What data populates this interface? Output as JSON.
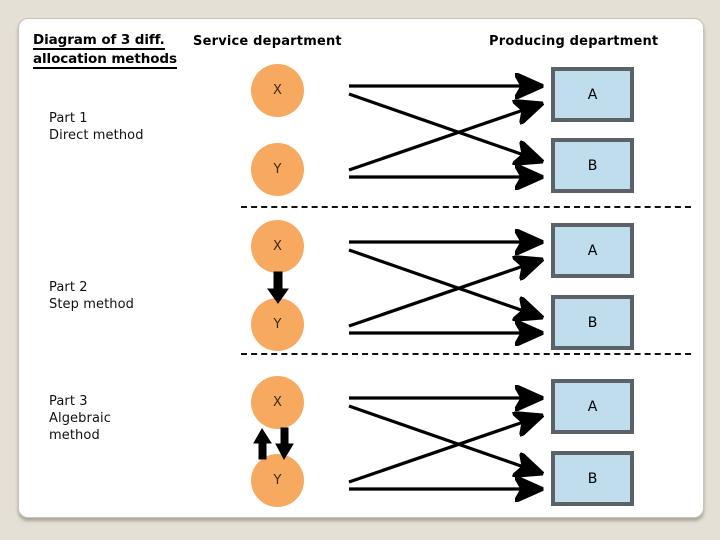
{
  "slide": {
    "title_line1": "Diagram of 3 diff.",
    "title_line2": "allocation methods",
    "column_headers": {
      "service": "Service department",
      "producing": "Producing department"
    },
    "colors": {
      "background": "#e5e0d6",
      "card": "#ffffff",
      "service_node_fill": "#f6a95f",
      "producing_node_fill": "#bfdded",
      "producing_node_border": "#5b6267",
      "arrow": "#000000",
      "divider": "#111111"
    },
    "sections": [
      {
        "id": "part-1",
        "label_line1": "Part 1",
        "label_line2": "Direct method",
        "label": "Part 1\nDirect method",
        "service_nodes": [
          "X",
          "Y"
        ],
        "producing_nodes": [
          "A",
          "B"
        ],
        "internal_arrows": [],
        "flow_arrows": [
          {
            "from": "X",
            "to": "A"
          },
          {
            "from": "X",
            "to": "B"
          },
          {
            "from": "Y",
            "to": "A"
          },
          {
            "from": "Y",
            "to": "B"
          }
        ]
      },
      {
        "id": "part-2",
        "label_line1": "Part 2",
        "label_line2": "Step method",
        "label": "Part 2\nStep method",
        "service_nodes": [
          "X",
          "Y"
        ],
        "producing_nodes": [
          "A",
          "B"
        ],
        "internal_arrows": [
          {
            "from": "X",
            "to": "Y",
            "direction": "down"
          }
        ],
        "flow_arrows": [
          {
            "from": "X",
            "to": "A"
          },
          {
            "from": "X",
            "to": "B"
          },
          {
            "from": "Y",
            "to": "A"
          },
          {
            "from": "Y",
            "to": "B"
          }
        ]
      },
      {
        "id": "part-3",
        "label_line1": "Part 3",
        "label_line2": "Algebraic",
        "label_line3": "method",
        "label": "Part 3\nAlgebraic\nmethod",
        "service_nodes": [
          "X",
          "Y"
        ],
        "producing_nodes": [
          "A",
          "B"
        ],
        "internal_arrows": [
          {
            "from": "Y",
            "to": "X",
            "direction": "up"
          },
          {
            "from": "X",
            "to": "Y",
            "direction": "down"
          }
        ],
        "flow_arrows": [
          {
            "from": "X",
            "to": "A"
          },
          {
            "from": "X",
            "to": "B"
          },
          {
            "from": "Y",
            "to": "A"
          },
          {
            "from": "Y",
            "to": "B"
          }
        ]
      }
    ],
    "dividers": 2
  }
}
